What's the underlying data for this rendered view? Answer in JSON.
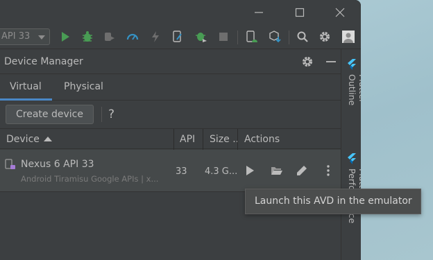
{
  "toolbar": {
    "api_select_value": "API 33"
  },
  "panel": {
    "title": "Device Manager"
  },
  "tabs": [
    {
      "label": "Virtual",
      "active": true
    },
    {
      "label": "Physical",
      "active": false
    }
  ],
  "actions": {
    "create_device_label": "Create device",
    "help_label": "?"
  },
  "table": {
    "columns": [
      "Device",
      "API",
      "Size ..",
      "Actions"
    ],
    "rows": [
      {
        "name": "Nexus 6 API 33",
        "subtitle": "Android Tiramisu Google APIs | x...",
        "api": "33",
        "size": "4.3 G..."
      }
    ]
  },
  "sidebar": {
    "items": [
      "Flutter Outline",
      "Flutter Performance"
    ]
  },
  "tooltip": {
    "text": "Launch this AVD in the emulator"
  },
  "colors": {
    "accent": "#4a88c7",
    "run_green": "#499c54",
    "flutter_blue": "#47c5fb"
  }
}
